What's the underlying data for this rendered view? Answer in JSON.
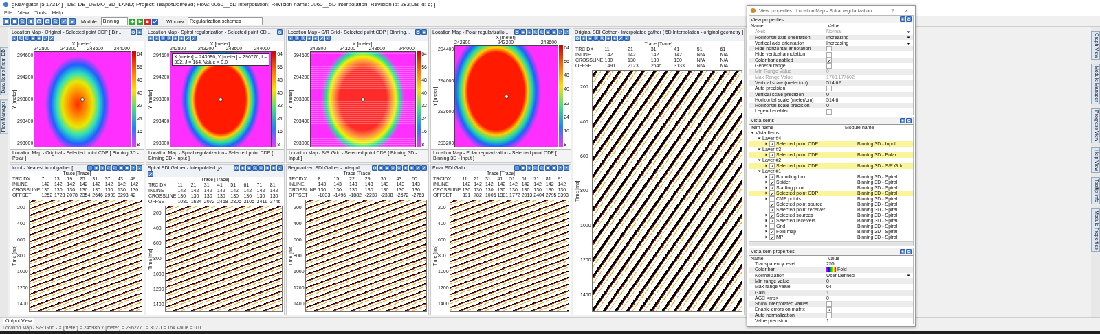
{
  "window": {
    "title": "gNavigator [5.17314] [ DB: DB_DEMO_3D_LAND; Project: TeapotDome3d; Flow: 0060__5D interpolation; Revision name: 0060__5D interpolation; Revision id: 283;DB id: 6; ]"
  },
  "menu": [
    "File",
    "View",
    "Tools",
    "Help"
  ],
  "toolbar": {
    "module_label": "Module :",
    "module_value": "Binning",
    "window_label": "Window :",
    "window_value": "Regularization schemes"
  },
  "left_dock": [
    "Data Items From DB",
    "Flow Manager"
  ],
  "right_dock": [
    "Graph View",
    "Module Manager",
    "Progress View",
    "Help View",
    "Tooltip Info",
    "Module Properties"
  ],
  "maps": [
    {
      "title": "Location Map - Original - Selected point CDP [ Bin...",
      "tab": "Location Map - Original - Selected point CDP [ Binning 3D - Polar ]",
      "kind": "original",
      "x_label": "X [meter]",
      "y_label": "Y [meter]",
      "xticks": [
        "242800",
        "243200",
        "243600",
        "244000"
      ],
      "yticks": [
        "294600",
        "294200",
        "293800",
        "293400",
        "293000"
      ],
      "cbar": [
        "64",
        "56",
        "48",
        "40",
        "32",
        "24",
        "16",
        "8"
      ]
    },
    {
      "title": "Location Map - Spiral regularization - Selected point CD...",
      "tab": "Location Map - Spiral regularization - Selected point CDP [ Binning 3D - Input ]",
      "kind": "spiral",
      "x_label": "X [meter]",
      "y_label": "Y [meter]",
      "xticks": [
        "242800",
        "243200",
        "243600",
        "244000"
      ],
      "yticks": [
        "294600",
        "294200",
        "293800",
        "293400",
        "293000"
      ],
      "cbar": [
        "64",
        "56",
        "48",
        "40",
        "32",
        "24",
        "16",
        "8"
      ],
      "tooltip": "X [meter] = 243686, Y [meter] = 296776, I = 302, J = 164, Value = 0.0"
    },
    {
      "title": "Location Map - S/R Grid - Selected point CDP [ Binning...",
      "tab": "Location Map - S/R Grid - Selected point CDP [ Binning 3D - Input ]",
      "kind": "grid",
      "x_label": "X [meter]",
      "y_label": "Y [meter]",
      "xticks": [
        "242800",
        "243200",
        "243600",
        "244000"
      ],
      "yticks": [
        "294600",
        "294200",
        "293800",
        "293400",
        "293000"
      ],
      "cbar": [
        "64",
        "56",
        "48",
        "40",
        "32",
        "24",
        "16",
        "8"
      ]
    },
    {
      "title": "Location Map - Polar regularizatio...",
      "tab": "Location Map - Polar regularization - Selected point CDP [ Binning 3D - Input ]",
      "kind": "polar",
      "x_label": "X [meter]",
      "y_label": "Y [meter]",
      "xticks": [
        "242800",
        "243200",
        "243600"
      ],
      "yticks": [
        "294400",
        "294000",
        "293600",
        "293200"
      ],
      "cbar": [
        "64",
        "56",
        "48",
        "40",
        "32",
        "24",
        "16",
        "8"
      ]
    }
  ],
  "big_gather": {
    "title": "Original SDI Gather - Interpolated gather [ 5D Interpolation - original geometry ]",
    "trace_label": "Trace [Trace]",
    "time_label": "Time [ms]",
    "rows": [
      {
        "name": "TRCIDX",
        "values": [
          "11",
          "21",
          "31",
          "41",
          "51",
          "61"
        ]
      },
      {
        "name": "INLINE",
        "values": [
          "142",
          "142",
          "142",
          "142",
          "N/A",
          "N/A"
        ]
      },
      {
        "name": "CROSSLINE",
        "values": [
          "130",
          "130",
          "130",
          "130",
          "N/A",
          "N/A"
        ]
      },
      {
        "name": "OFFSET",
        "values": [
          "1491",
          "2123",
          "2646",
          "3133",
          "N/A",
          "N/A"
        ]
      }
    ],
    "time_ticks": [
      "200",
      "400",
      "600",
      "800",
      "1000",
      "1200",
      "1400"
    ]
  },
  "gathers": [
    {
      "title": "Input - Nearest input gather [...",
      "trace_label": "Trace [Trace]",
      "time_label": "Time [ms]",
      "rows": [
        {
          "name": "TRCIDX",
          "values": [
            "7",
            "13",
            "19",
            "25",
            "31",
            "37",
            "43",
            "49"
          ]
        },
        {
          "name": "INLINE",
          "values": [
            "142",
            "142",
            "142",
            "142",
            "142",
            "142",
            "142",
            "142"
          ]
        },
        {
          "name": "CROSSLINE",
          "values": [
            "130",
            "130",
            "130",
            "130",
            "130",
            "130",
            "130",
            "130"
          ]
        },
        {
          "name": "OFFSET",
          "values": [
            "1252",
            "1723",
            "2078",
            "2354",
            "2646",
            "2999",
            "3293",
            "42"
          ]
        }
      ],
      "time_ticks": [
        "200",
        "400",
        "600",
        "800",
        "1000",
        "1200",
        "1400"
      ]
    },
    {
      "title": "Spiral SDI Gather - Interpolated ga...",
      "trace_label": "Trace [Trace]",
      "time_label": "Time [ms]",
      "rows": [
        {
          "name": "TRCIDX",
          "values": [
            "11",
            "21",
            "31",
            "41",
            "51",
            "61",
            "71",
            "81"
          ]
        },
        {
          "name": "INLINE",
          "values": [
            "142",
            "142",
            "142",
            "142",
            "142",
            "142",
            "142",
            "142"
          ]
        },
        {
          "name": "CROSSLINE",
          "values": [
            "130",
            "130",
            "130",
            "130",
            "130",
            "130",
            "130",
            "130"
          ]
        },
        {
          "name": "OFFSET",
          "values": [
            "1080",
            "1624",
            "2072",
            "2468",
            "2806",
            "3106",
            "3411",
            "3746"
          ]
        }
      ],
      "time_ticks": [
        "200",
        "400",
        "600",
        "800",
        "1000",
        "1200",
        "1400"
      ]
    },
    {
      "title": "Regularized SDI Gather - Interpol...",
      "trace_label": "Trace [Trace]",
      "time_label": "Time [ms]",
      "rows": [
        {
          "name": "TRCIDX",
          "values": [
            "8",
            "15",
            "22",
            "29",
            "36",
            "43",
            "50"
          ]
        },
        {
          "name": "INLINE",
          "values": [
            "143",
            "143",
            "143",
            "143",
            "143",
            "143",
            "143"
          ]
        },
        {
          "name": "CROSSLINE",
          "values": [
            "130",
            "130",
            "130",
            "130",
            "130",
            "130",
            "130"
          ]
        },
        {
          "name": "OFFSET",
          "values": [
            "-1033",
            "-1496",
            "-1882",
            "-2239",
            "-2398",
            "-2572",
            "-2763"
          ]
        }
      ],
      "time_ticks": [
        "200",
        "400",
        "600",
        "800",
        "1000",
        "1200",
        "1400"
      ]
    },
    {
      "title": "Polar SDI Gath...",
      "trace_label": "Trace [Trace]",
      "time_label": "Time [ms]",
      "rows": [
        {
          "name": "TRCIDX",
          "values": [
            "11",
            "21",
            "31",
            "41",
            "51",
            "61",
            "71",
            "81",
            "91"
          ]
        },
        {
          "name": "INLINE",
          "values": [
            "142",
            "142",
            "142",
            "142",
            "142",
            "142",
            "142",
            "142",
            "142"
          ]
        },
        {
          "name": "CROSSLINE",
          "values": [
            "130",
            "130",
            "130",
            "130",
            "130",
            "130",
            "130",
            "130",
            "130"
          ]
        },
        {
          "name": "OFFSET",
          "values": [
            "391",
            "782",
            "1006",
            "1381",
            "1772",
            "2013",
            "2404",
            "2795",
            "3393"
          ]
        }
      ],
      "time_ticks": [
        "200",
        "400",
        "600",
        "800",
        "1000",
        "1200",
        "1400"
      ]
    }
  ],
  "dialog": {
    "title": "View properties : Location Map - Spiral regularization",
    "help": "?",
    "close": "×",
    "view_properties": {
      "title": "View properties",
      "name_header": "Name",
      "value_header": "Value",
      "rows": [
        {
          "kind": "dropdown",
          "name": "Axes",
          "value": "Normal",
          "disabled": true
        },
        {
          "kind": "dropdown",
          "name": "Horizontal axis orientation",
          "value": "Increasing",
          "disabled": false
        },
        {
          "kind": "dropdown",
          "name": "Vertical axis orientation",
          "value": "Increasing",
          "disabled": false
        },
        {
          "kind": "check",
          "name": "Hide horizontal annotation",
          "checked": false,
          "disabled": false
        },
        {
          "kind": "check",
          "name": "Hide vertical annotation",
          "checked": false,
          "disabled": false
        },
        {
          "kind": "check",
          "name": "Color bar enabled",
          "checked": true,
          "disabled": false
        },
        {
          "kind": "check",
          "name": "General range",
          "checked": false,
          "disabled": false
        },
        {
          "kind": "text",
          "name": "Min Range Value",
          "value": "0",
          "disabled": true
        },
        {
          "kind": "text",
          "name": "Max Range Value",
          "value": "1708.177602",
          "disabled": true
        },
        {
          "kind": "text",
          "name": "Vertical scale (meter/cm)",
          "value": "514.62",
          "disabled": false
        },
        {
          "kind": "check",
          "name": "Auto precision",
          "checked": false,
          "disabled": false
        },
        {
          "kind": "text",
          "name": "Vertical scale precision",
          "value": "0",
          "disabled": false
        },
        {
          "kind": "text",
          "name": "Horizontal scale (meter/cm)",
          "value": "514.6",
          "disabled": false
        },
        {
          "kind": "text",
          "name": "Horizontal scale precision",
          "value": "0",
          "disabled": false
        },
        {
          "kind": "check",
          "name": "Legend enabled",
          "checked": false,
          "disabled": false
        }
      ]
    },
    "vista_items": {
      "title": "Vista items",
      "name_header": "Item name",
      "module_header": "Module name",
      "tree": [
        {
          "name": "Vista Items",
          "expanded": true,
          "children": [
            {
              "name": "Layer #4",
              "expanded": true,
              "children": [
                {
                  "name": "Selected point CDP",
                  "module": "Binning 3D - Input",
                  "checked": true,
                  "selected": true,
                  "expanded": false
                }
              ]
            },
            {
              "name": "Layer #3",
              "expanded": true,
              "children": [
                {
                  "name": "Selected point CDP",
                  "module": "Binning 3D - Polar",
                  "checked": true,
                  "selected": true,
                  "expanded": false
                }
              ]
            },
            {
              "name": "Layer #2",
              "expanded": true,
              "children": [
                {
                  "name": "Selected point CDP",
                  "module": "Binning 3D - S/R Grid",
                  "checked": true,
                  "selected": true,
                  "expanded": false
                }
              ]
            },
            {
              "name": "Layer #1",
              "expanded": true,
              "children": [
                {
                  "name": "Bounding box",
                  "module": "Binning 3D - Spiral",
                  "checked": true,
                  "selected": false,
                  "expanded": false
                },
                {
                  "name": "Spider",
                  "module": "Binning 3D - Spiral",
                  "checked": true,
                  "selected": false,
                  "expanded": false
                },
                {
                  "name": "Starting point",
                  "module": "Binning 3D - Spiral",
                  "checked": true,
                  "selected": false,
                  "expanded": false
                },
                {
                  "name": "Selected point CDP",
                  "module": "Binning 3D - Spiral",
                  "checked": true,
                  "selected": true,
                  "expanded": false
                },
                {
                  "name": "CMP points",
                  "module": "Binning 3D - Spiral",
                  "checked": false,
                  "selected": false,
                  "expanded": false
                },
                {
                  "name": "Selected point source",
                  "module": "Binning 3D - Spiral",
                  "checked": true,
                  "selected": false
                },
                {
                  "name": "Selected point receiver",
                  "module": "Binning 3D - Spiral",
                  "checked": true,
                  "selected": false
                },
                {
                  "name": "Selected sources",
                  "module": "Binning 3D - Spiral",
                  "checked": true,
                  "selected": false,
                  "expanded": false
                },
                {
                  "name": "Selected receivers",
                  "module": "Binning 3D - Spiral",
                  "checked": true,
                  "selected": false,
                  "expanded": false
                },
                {
                  "name": "Grid",
                  "module": "Binning 3D - Spiral",
                  "checked": false,
                  "selected": false,
                  "expanded": false
                },
                {
                  "name": "Fold map",
                  "module": "Binning 3D - Spiral",
                  "checked": true,
                  "selected": false,
                  "expanded": false
                },
                {
                  "name": "MP",
                  "module": "Binning 3D - Spiral",
                  "checked": true,
                  "selected": false,
                  "expanded": false
                }
              ]
            }
          ]
        }
      ]
    },
    "item_properties": {
      "title": "Vista item properties",
      "name_header": "Name",
      "value_header": "Value",
      "rows": [
        {
          "kind": "text",
          "name": "Transparency level",
          "value": "255"
        },
        {
          "kind": "colorbar",
          "name": "Color bar",
          "value": "Fold"
        },
        {
          "kind": "dropdown",
          "name": "Normalization",
          "value": "User Defined"
        },
        {
          "kind": "text",
          "name": "Min range value",
          "value": "0"
        },
        {
          "kind": "text",
          "name": "Max range value",
          "value": "64"
        },
        {
          "kind": "text",
          "name": "Gain",
          "value": "1"
        },
        {
          "kind": "text",
          "name": "AGC <ms>",
          "value": "0"
        },
        {
          "kind": "check",
          "name": "Show interpolated values",
          "checked": false
        },
        {
          "kind": "check",
          "name": "Enable errors on matrix",
          "checked": true
        },
        {
          "kind": "check",
          "name": "Auto normalization",
          "checked": false
        },
        {
          "kind": "text",
          "name": "Value precision",
          "value": "1"
        }
      ]
    }
  },
  "output_tab": "Output View",
  "status_bar": "Location Map - S/R Grid - X [meter] = 245985 Y [meter] = 296277 I = 302 J = 164 Value = 0.0"
}
